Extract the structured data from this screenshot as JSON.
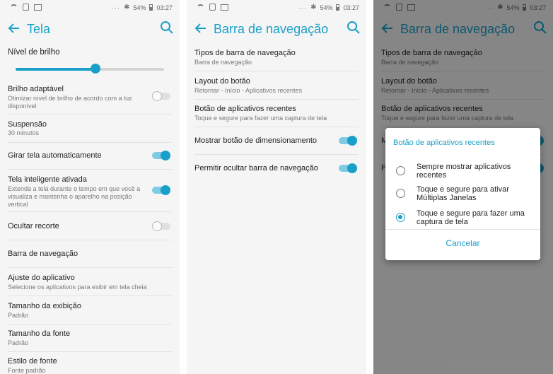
{
  "colors": {
    "accent": "#1aa0c8",
    "background": "#f5f5f5"
  },
  "status_bar": {
    "battery": "54%",
    "time": "03:27",
    "dots": "···"
  },
  "screen1": {
    "title": "Tela",
    "brightness_label": "Nível de brilho",
    "brightness_level": 0.54,
    "items": [
      {
        "title": "Brilho adaptável",
        "subtitle": "Otimizar nível de brilho de acordo com a luz disponível",
        "toggle": false
      },
      {
        "title": "Suspensão",
        "subtitle": "30 minutos"
      },
      {
        "title": "Girar tela automaticamente",
        "toggle": true
      },
      {
        "title": "Tela inteligente ativada",
        "subtitle": "Extenda a tela durante o tempo em que você a visualiza e mantenha o aparelho na posição vertical",
        "toggle": true
      },
      {
        "title": "Ocultar recorte",
        "toggle": false
      },
      {
        "title": "Barra de navegação"
      },
      {
        "title": "Ajuste do aplicativo",
        "subtitle": "Selecione os aplicativos para exibir em tela cheia"
      },
      {
        "title": "Tamanho da exibição",
        "subtitle": "Padrão"
      },
      {
        "title": "Tamanho da fonte",
        "subtitle": "Padrão"
      },
      {
        "title": "Estilo de fonte",
        "subtitle": "Fonte padrão"
      }
    ]
  },
  "screen2": {
    "title": "Barra de navegação",
    "items": [
      {
        "title": "Tipos de barra de navegação",
        "subtitle": "Barra de navegação"
      },
      {
        "title": "Layout do botão",
        "subtitle": "Retornar - Início - Aplicativos recentes"
      },
      {
        "title": "Botão de aplicativos recentes",
        "subtitle": "Toque e segure para fazer uma captura de tela"
      },
      {
        "title": "Mostrar botão de dimensionamento",
        "toggle": true
      },
      {
        "title": "Permitir ocultar barra de navegação",
        "toggle": true
      }
    ]
  },
  "dialog": {
    "title": "Botão de aplicativos recentes",
    "options": [
      {
        "label": "Sempre mostrar aplicativos recentes",
        "checked": false
      },
      {
        "label": "Toque e segure para ativar Múltiplas Janelas",
        "checked": false
      },
      {
        "label": "Toque e segure para fazer uma captura de tela",
        "checked": true
      }
    ],
    "cancel": "Cancelar"
  }
}
